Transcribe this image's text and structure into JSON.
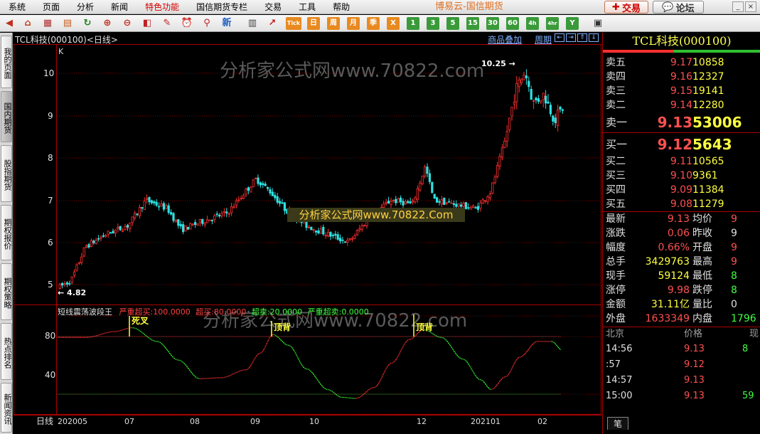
{
  "menubar": {
    "items": [
      "系统",
      "页面",
      "分析",
      "新闻",
      "特色功能",
      "国信期货专栏",
      "交易",
      "工具",
      "帮助"
    ],
    "brand": "博易云-国信期货",
    "trade_label": "交易",
    "forum_label": "论坛"
  },
  "toolbar": {
    "buttons": [
      "Tick",
      "日",
      "周",
      "月",
      "季",
      "X",
      "1",
      "3",
      "5",
      "15",
      "30",
      "60",
      "4h",
      "4hr",
      "Y"
    ]
  },
  "left_tabs": [
    "我的页面",
    "国内期货",
    "股指期货",
    "期权报价",
    "期权策略",
    "热点排名",
    "新闻资讯"
  ],
  "chart": {
    "title": "TCL科技(000100)<日线>",
    "link_overlay": "商品叠加",
    "link_period": "周期",
    "k_label": "K",
    "watermark": "分析家公式网www.70822.com",
    "banner": "分析家公式网www.70822.Com",
    "indicator": {
      "name": "短线震荡波段王",
      "l1": "严重超买:100.0000",
      "l2": "超买:80.0000",
      "l3": "超卖:20.0000",
      "l4": "严重超卖:0.0000",
      "signals": [
        "死叉",
        "顶背",
        "顶背"
      ]
    },
    "bottom_tab": "日线",
    "x_labels": [
      "202005",
      "07",
      "08",
      "09",
      "10",
      "12",
      "202101",
      "02"
    ],
    "main_axis": [
      "10",
      "9",
      "8",
      "7",
      "6",
      "5"
    ],
    "ind_axis": [
      "80",
      "40"
    ],
    "high_mark": "10.25",
    "low_mark": "4.82"
  },
  "chart_data": {
    "type": "candlestick",
    "title": "TCL科技(000100)<日线>",
    "y_range": [
      4.7,
      10.5
    ],
    "high": 10.25,
    "low": 4.82,
    "indicator_range": [
      0,
      100
    ],
    "indicator_levels": [
      100,
      80,
      20,
      0
    ]
  },
  "quote": {
    "title": "TCL科技(000100)",
    "asks": [
      {
        "label": "卖五",
        "price": "9.17",
        "vol": "10858"
      },
      {
        "label": "卖四",
        "price": "9.16",
        "vol": "12327"
      },
      {
        "label": "卖三",
        "price": "9.15",
        "vol": "19141"
      },
      {
        "label": "卖二",
        "price": "9.14",
        "vol": "12280"
      },
      {
        "label": "卖一",
        "price": "9.13",
        "vol": "53006"
      }
    ],
    "bids": [
      {
        "label": "买一",
        "price": "9.12",
        "vol": "5643"
      },
      {
        "label": "买二",
        "price": "9.11",
        "vol": "10565"
      },
      {
        "label": "买三",
        "price": "9.10",
        "vol": "9361"
      },
      {
        "label": "买四",
        "price": "9.09",
        "vol": "11384"
      },
      {
        "label": "买五",
        "price": "9.08",
        "vol": "11279"
      }
    ],
    "stats": [
      {
        "l1": "最新",
        "v1": "9.13",
        "c1": "red",
        "l2": "均价",
        "v2": "9",
        "c2": "red"
      },
      {
        "l1": "涨跌",
        "v1": "0.06",
        "c1": "red",
        "l2": "昨收",
        "v2": "9",
        "c2": "wht"
      },
      {
        "l1": "幅度",
        "v1": "0.66%",
        "c1": "red",
        "l2": "开盘",
        "v2": "9",
        "c2": "red"
      },
      {
        "l1": "总手",
        "v1": "3429763",
        "c1": "yel",
        "l2": "最高",
        "v2": "9",
        "c2": "red"
      },
      {
        "l1": "现手",
        "v1": "59124",
        "c1": "yel",
        "l2": "最低",
        "v2": "8",
        "c2": "grn"
      },
      {
        "l1": "涨停",
        "v1": "9.98",
        "c1": "red",
        "l2": "跌停",
        "v2": "8",
        "c2": "grn"
      },
      {
        "l1": "金额",
        "v1": "31.11亿",
        "c1": "yel",
        "l2": "量比",
        "v2": "0",
        "c2": "wht"
      },
      {
        "l1": "外盘",
        "v1": "1633349",
        "c1": "red",
        "l2": "内盘",
        "v2": "1796",
        "c2": "grn"
      }
    ],
    "ticks_header": {
      "place": "北京",
      "price": "价格",
      "vol": "现"
    },
    "ticks": [
      {
        "time": "14:56",
        "price": "9.13",
        "vol": "8"
      },
      {
        "time": ":57",
        "price": "9.12",
        "vol": ""
      },
      {
        "time": "14:57",
        "price": "9.13",
        "vol": ""
      },
      {
        "time": "15:00",
        "price": "9.13",
        "vol": "59"
      }
    ],
    "bottom_tab": "笔"
  }
}
